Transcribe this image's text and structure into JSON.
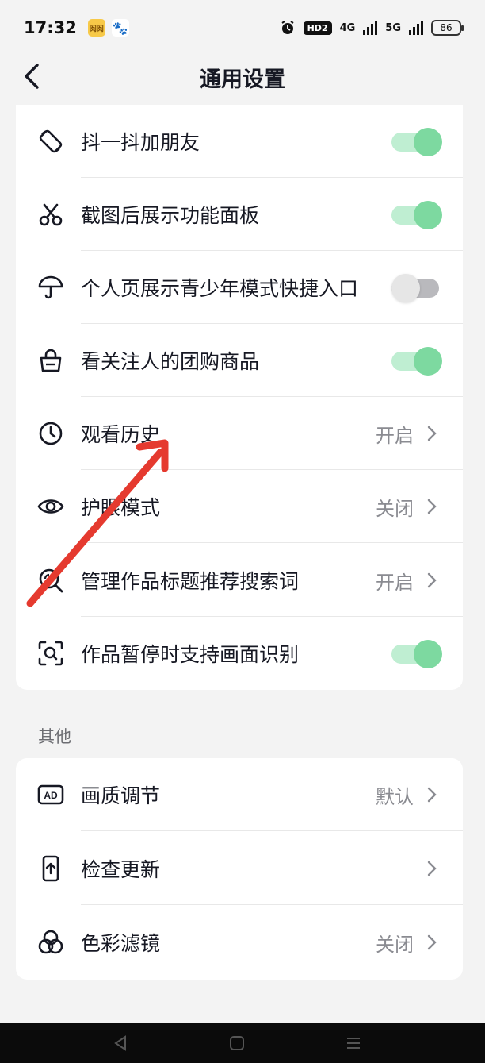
{
  "status_bar": {
    "time": "17:32",
    "app_badge_text": "阅阅",
    "paw_glyph": "🐾",
    "hd_label": "HD2",
    "net1": "4G",
    "net2": "5G",
    "battery": "86"
  },
  "nav": {
    "title": "通用设置"
  },
  "settings": [
    {
      "label": "抖一抖加朋友",
      "icon": "rotate-phone-icon",
      "type": "toggle",
      "on": true
    },
    {
      "label": "截图后展示功能面板",
      "icon": "scissors-icon",
      "type": "toggle",
      "on": true
    },
    {
      "label": "个人页展示青少年模式快捷入口",
      "icon": "umbrella-icon",
      "type": "toggle",
      "on": false
    },
    {
      "label": "看关注人的团购商品",
      "icon": "shopping-bag-icon",
      "type": "toggle",
      "on": true
    },
    {
      "label": "观看历史",
      "icon": "clock-icon",
      "type": "link",
      "value": "开启"
    },
    {
      "label": "护眼模式",
      "icon": "eye-icon",
      "type": "link",
      "value": "关闭"
    },
    {
      "label": "管理作品标题推荐搜索词",
      "icon": "search-icon",
      "type": "link",
      "value": "开启"
    },
    {
      "label": "作品暂停时支持画面识别",
      "icon": "scan-icon",
      "type": "toggle",
      "on": true
    }
  ],
  "other_section": {
    "header": "其他",
    "items": [
      {
        "label": "画质调节",
        "icon": "ad-icon",
        "value": "默认"
      },
      {
        "label": "检查更新",
        "icon": "phone-update-icon",
        "value": ""
      },
      {
        "label": "色彩滤镜",
        "icon": "color-filter-icon",
        "value": "关闭"
      }
    ]
  },
  "colors": {
    "toggle_on_track": "#bfeed2",
    "toggle_on_knob": "#7dd9a0",
    "annotation_arrow": "#e53a2f"
  }
}
